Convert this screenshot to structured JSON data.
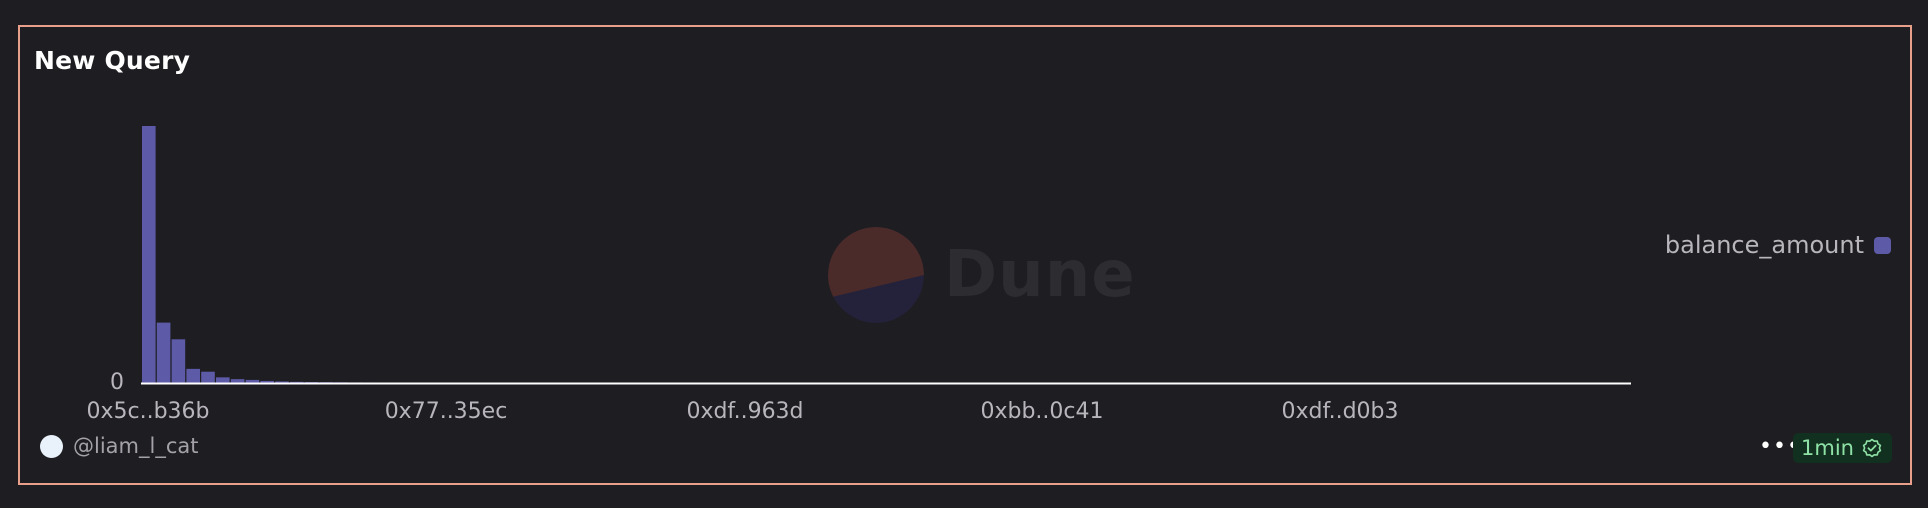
{
  "card": {
    "title": "New Query",
    "watermark": "Dune",
    "user": "@liam_l_cat",
    "refresh_label": "1min",
    "more_icon": "more-horizontal-icon",
    "refresh_icon": "check-badge-icon"
  },
  "colors": {
    "background": "#1e1d21",
    "border": "#e8a08c",
    "bar": "#5d5aa8",
    "axis": "#ffffff",
    "refresh_bg": "#123020",
    "refresh_text": "#8fe2a6"
  },
  "chart_data": {
    "type": "bar",
    "title": "",
    "xlabel": "",
    "ylabel": "",
    "x_tick_labels": [
      "0x5c..b36b",
      "0x77..35ec",
      "0xdf..963d",
      "0xbb..0c41",
      "0xdf..d0b3"
    ],
    "y_tick_labels": [
      "0"
    ],
    "ylim": [
      0,
      100
    ],
    "legend": {
      "position": "right",
      "entries": [
        "balance_amount"
      ]
    },
    "grid": false,
    "series": [
      {
        "name": "balance_amount",
        "values": [
          100,
          23.5,
          17,
          5.5,
          4.4,
          2.2,
          1.5,
          1.2,
          0.8,
          0.6,
          0.45,
          0.38,
          0.32,
          0.27,
          0.23,
          0.2,
          0.18,
          0.16,
          0.14,
          0.12,
          0.11,
          0.1,
          0.09,
          0.08,
          0.075,
          0.07,
          0.065,
          0.06,
          0.055,
          0.05,
          0.045,
          0.042,
          0.04,
          0.037,
          0.035,
          0.032,
          0.03,
          0.028,
          0.026,
          0.024,
          0.022,
          0.02,
          0.019,
          0.018,
          0.017,
          0.016,
          0.015,
          0.014,
          0.013,
          0.012,
          0.011,
          0.01,
          0.009,
          0.008,
          0.007,
          0.006,
          0.005,
          0.004,
          0.003,
          0.002
        ]
      }
    ]
  }
}
